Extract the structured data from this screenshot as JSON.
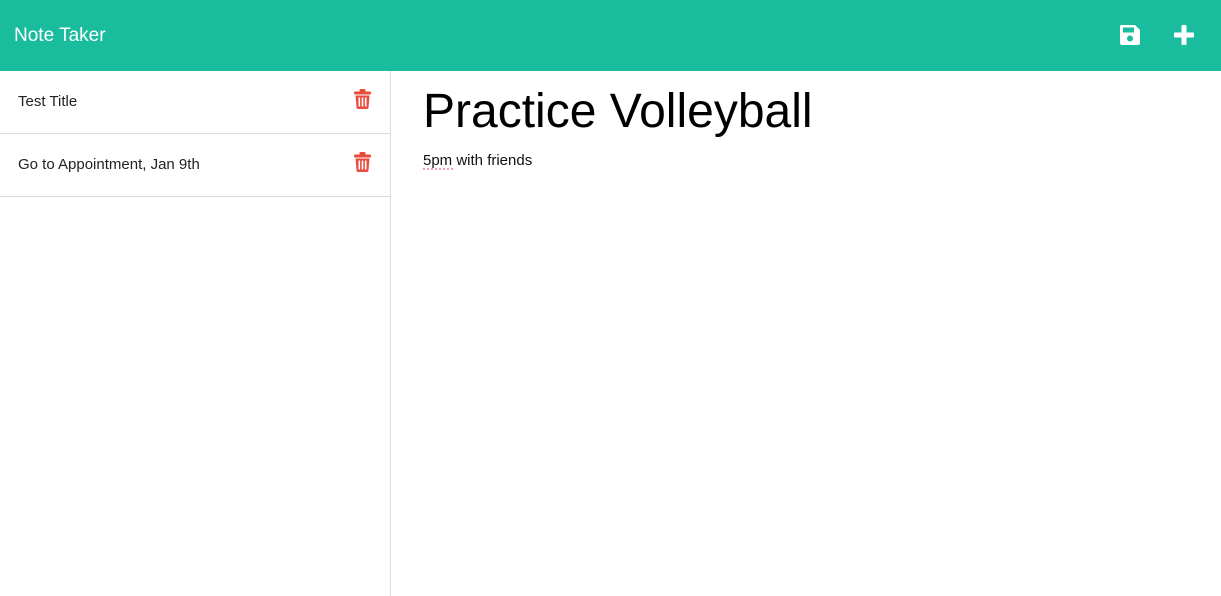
{
  "app": {
    "brand": "Note Taker"
  },
  "toolbar": {
    "save_icon": "floppy-disk-icon",
    "add_icon": "plus-icon",
    "icon_color": "#ffffff"
  },
  "colors": {
    "navbar": "#19bc9c",
    "delete_icon": "#e74c3c"
  },
  "sidebar": {
    "notes": [
      {
        "title": "Test Title",
        "delete_icon": "trash-icon"
      },
      {
        "title": "Go to Appointment, Jan 9th",
        "delete_icon": "trash-icon"
      }
    ]
  },
  "editor": {
    "title_value": "Practice Volleyball",
    "text_value": "5pm with friends"
  }
}
